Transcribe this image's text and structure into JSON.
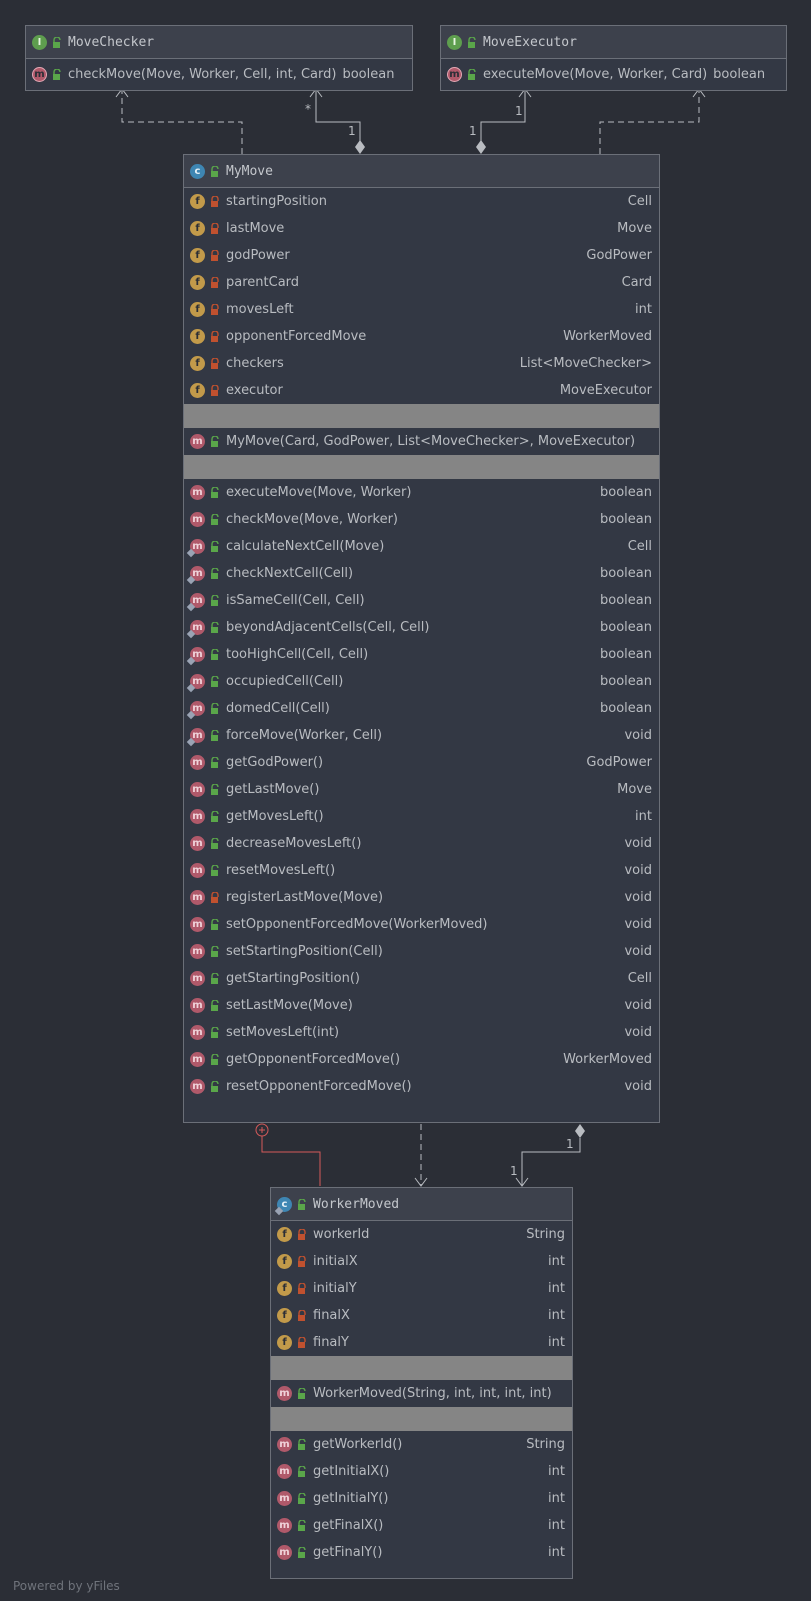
{
  "diagram": {
    "footer": "Powered by yFiles",
    "colors": {
      "background": "#2b2e36",
      "node_fill": "#333844",
      "header_fill": "#3d414c",
      "border": "#6b6f78",
      "field_badge": "#c29a4a",
      "method_badge": "#b0596a",
      "class_badge": "#3e86b3",
      "interface_badge": "#5e9e4e",
      "private_lock": "#c0512f",
      "public_lock": "#5aa64a",
      "inner_edge": "#d45a5a"
    },
    "nodes": {
      "move_checker": {
        "title": "MoveChecker",
        "kind": "interface",
        "methods": [
          {
            "name": "checkMove(Move, Worker, Cell, int, Card)",
            "type": "boolean",
            "visibility": "public",
            "abstract": true
          }
        ]
      },
      "move_executor": {
        "title": "MoveExecutor",
        "kind": "interface",
        "methods": [
          {
            "name": "executeMove(Move, Worker, Card)",
            "type": "boolean",
            "visibility": "public",
            "abstract": true
          }
        ]
      },
      "my_move": {
        "title": "MyMove",
        "kind": "class",
        "fields": [
          {
            "name": "startingPosition",
            "type": "Cell",
            "visibility": "private"
          },
          {
            "name": "lastMove",
            "type": "Move",
            "visibility": "private"
          },
          {
            "name": "godPower",
            "type": "GodPower",
            "visibility": "private"
          },
          {
            "name": "parentCard",
            "type": "Card",
            "visibility": "private"
          },
          {
            "name": "movesLeft",
            "type": "int",
            "visibility": "private"
          },
          {
            "name": "opponentForcedMove",
            "type": "WorkerMoved",
            "visibility": "private"
          },
          {
            "name": "checkers",
            "type": "List<MoveChecker>",
            "visibility": "private"
          },
          {
            "name": "executor",
            "type": "MoveExecutor",
            "visibility": "private"
          }
        ],
        "constructors": [
          {
            "name": "MyMove(Card, GodPower, List<MoveChecker>, MoveExecutor)",
            "type": "",
            "visibility": "public"
          }
        ],
        "methods": [
          {
            "name": "executeMove(Move, Worker)",
            "type": "boolean",
            "visibility": "public",
            "static": false
          },
          {
            "name": "checkMove(Move, Worker)",
            "type": "boolean",
            "visibility": "public",
            "static": false
          },
          {
            "name": "calculateNextCell(Move)",
            "type": "Cell",
            "visibility": "public",
            "static": true
          },
          {
            "name": "checkNextCell(Cell)",
            "type": "boolean",
            "visibility": "public",
            "static": true
          },
          {
            "name": "isSameCell(Cell, Cell)",
            "type": "boolean",
            "visibility": "public",
            "static": true
          },
          {
            "name": "beyondAdjacentCells(Cell, Cell)",
            "type": "boolean",
            "visibility": "public",
            "static": true
          },
          {
            "name": "tooHighCell(Cell, Cell)",
            "type": "boolean",
            "visibility": "public",
            "static": true
          },
          {
            "name": "occupiedCell(Cell)",
            "type": "boolean",
            "visibility": "public",
            "static": true
          },
          {
            "name": "domedCell(Cell)",
            "type": "boolean",
            "visibility": "public",
            "static": true
          },
          {
            "name": "forceMove(Worker, Cell)",
            "type": "void",
            "visibility": "public",
            "static": true
          },
          {
            "name": "getGodPower()",
            "type": "GodPower",
            "visibility": "public",
            "static": false
          },
          {
            "name": "getLastMove()",
            "type": "Move",
            "visibility": "public",
            "static": false
          },
          {
            "name": "getMovesLeft()",
            "type": "int",
            "visibility": "public",
            "static": false
          },
          {
            "name": "decreaseMovesLeft()",
            "type": "void",
            "visibility": "public",
            "static": false
          },
          {
            "name": "resetMovesLeft()",
            "type": "void",
            "visibility": "public",
            "static": false
          },
          {
            "name": "registerLastMove(Move)",
            "type": "void",
            "visibility": "private",
            "static": false
          },
          {
            "name": "setOpponentForcedMove(WorkerMoved)",
            "type": "void",
            "visibility": "public",
            "static": false
          },
          {
            "name": "setStartingPosition(Cell)",
            "type": "void",
            "visibility": "public",
            "static": false
          },
          {
            "name": "getStartingPosition()",
            "type": "Cell",
            "visibility": "public",
            "static": false
          },
          {
            "name": "setLastMove(Move)",
            "type": "void",
            "visibility": "public",
            "static": false
          },
          {
            "name": "setMovesLeft(int)",
            "type": "void",
            "visibility": "public",
            "static": false
          },
          {
            "name": "getOpponentForcedMove()",
            "type": "WorkerMoved",
            "visibility": "public",
            "static": false
          },
          {
            "name": "resetOpponentForcedMove()",
            "type": "void",
            "visibility": "public",
            "static": false
          }
        ]
      },
      "worker_moved": {
        "title": "WorkerMoved",
        "kind": "class",
        "static_class": true,
        "fields": [
          {
            "name": "workerId",
            "type": "String",
            "visibility": "private"
          },
          {
            "name": "initialX",
            "type": "int",
            "visibility": "private"
          },
          {
            "name": "initialY",
            "type": "int",
            "visibility": "private"
          },
          {
            "name": "finalX",
            "type": "int",
            "visibility": "private"
          },
          {
            "name": "finalY",
            "type": "int",
            "visibility": "private"
          }
        ],
        "constructors": [
          {
            "name": "WorkerMoved(String, int, int, int, int)",
            "type": "",
            "visibility": "public"
          }
        ],
        "methods": [
          {
            "name": "getWorkerId()",
            "type": "String",
            "visibility": "public",
            "static": false
          },
          {
            "name": "getInitialX()",
            "type": "int",
            "visibility": "public",
            "static": false
          },
          {
            "name": "getInitialY()",
            "type": "int",
            "visibility": "public",
            "static": false
          },
          {
            "name": "getFinalX()",
            "type": "int",
            "visibility": "public",
            "static": false
          },
          {
            "name": "getFinalY()",
            "type": "int",
            "visibility": "public",
            "static": false
          }
        ]
      }
    },
    "edges": [
      {
        "from": "my_move",
        "to": "move_checker",
        "kind": "implements"
      },
      {
        "from": "my_move",
        "to": "move_checker",
        "kind": "aggregation",
        "source_multiplicity": "1",
        "target_multiplicity": "*"
      },
      {
        "from": "my_move",
        "to": "move_executor",
        "kind": "aggregation",
        "source_multiplicity": "1",
        "target_multiplicity": "1"
      },
      {
        "from": "my_move",
        "to": "move_executor",
        "kind": "implements"
      },
      {
        "from": "my_move",
        "to": "worker_moved",
        "kind": "inner_class"
      },
      {
        "from": "my_move",
        "to": "worker_moved",
        "kind": "dependency"
      },
      {
        "from": "my_move",
        "to": "worker_moved",
        "kind": "aggregation",
        "source_multiplicity": "1",
        "target_multiplicity": "1"
      }
    ]
  }
}
